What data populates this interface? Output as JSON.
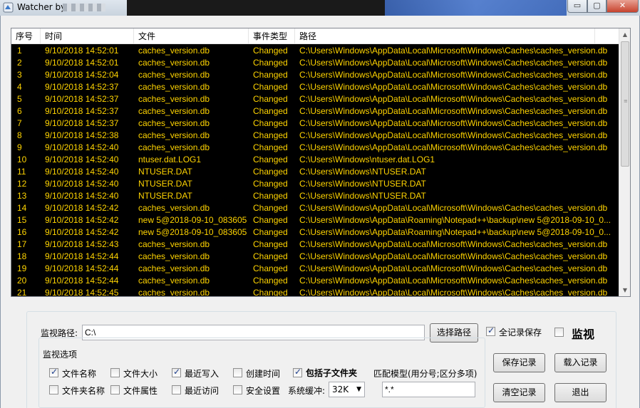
{
  "window": {
    "title": "Watcher by",
    "minimize_glyph": "▭",
    "maximize_glyph": "▢",
    "close_glyph": "✕"
  },
  "list": {
    "columns": [
      "序号",
      "时间",
      "文件",
      "事件类型",
      "路径"
    ],
    "rows": [
      [
        "1",
        "9/10/2018 14:52:01",
        "caches_version.db",
        "Changed",
        "C:\\Users\\Windows\\AppData\\Local\\Microsoft\\Windows\\Caches\\caches_version.db"
      ],
      [
        "2",
        "9/10/2018 14:52:01",
        "caches_version.db",
        "Changed",
        "C:\\Users\\Windows\\AppData\\Local\\Microsoft\\Windows\\Caches\\caches_version.db"
      ],
      [
        "3",
        "9/10/2018 14:52:04",
        "caches_version.db",
        "Changed",
        "C:\\Users\\Windows\\AppData\\Local\\Microsoft\\Windows\\Caches\\caches_version.db"
      ],
      [
        "4",
        "9/10/2018 14:52:37",
        "caches_version.db",
        "Changed",
        "C:\\Users\\Windows\\AppData\\Local\\Microsoft\\Windows\\Caches\\caches_version.db"
      ],
      [
        "5",
        "9/10/2018 14:52:37",
        "caches_version.db",
        "Changed",
        "C:\\Users\\Windows\\AppData\\Local\\Microsoft\\Windows\\Caches\\caches_version.db"
      ],
      [
        "6",
        "9/10/2018 14:52:37",
        "caches_version.db",
        "Changed",
        "C:\\Users\\Windows\\AppData\\Local\\Microsoft\\Windows\\Caches\\caches_version.db"
      ],
      [
        "7",
        "9/10/2018 14:52:37",
        "caches_version.db",
        "Changed",
        "C:\\Users\\Windows\\AppData\\Local\\Microsoft\\Windows\\Caches\\caches_version.db"
      ],
      [
        "8",
        "9/10/2018 14:52:38",
        "caches_version.db",
        "Changed",
        "C:\\Users\\Windows\\AppData\\Local\\Microsoft\\Windows\\Caches\\caches_version.db"
      ],
      [
        "9",
        "9/10/2018 14:52:40",
        "caches_version.db",
        "Changed",
        "C:\\Users\\Windows\\AppData\\Local\\Microsoft\\Windows\\Caches\\caches_version.db"
      ],
      [
        "10",
        "9/10/2018 14:52:40",
        "ntuser.dat.LOG1",
        "Changed",
        "C:\\Users\\Windows\\ntuser.dat.LOG1"
      ],
      [
        "11",
        "9/10/2018 14:52:40",
        "NTUSER.DAT",
        "Changed",
        "C:\\Users\\Windows\\NTUSER.DAT"
      ],
      [
        "12",
        "9/10/2018 14:52:40",
        "NTUSER.DAT",
        "Changed",
        "C:\\Users\\Windows\\NTUSER.DAT"
      ],
      [
        "13",
        "9/10/2018 14:52:40",
        "NTUSER.DAT",
        "Changed",
        "C:\\Users\\Windows\\NTUSER.DAT"
      ],
      [
        "14",
        "9/10/2018 14:52:42",
        "caches_version.db",
        "Changed",
        "C:\\Users\\Windows\\AppData\\Local\\Microsoft\\Windows\\Caches\\caches_version.db"
      ],
      [
        "15",
        "9/10/2018 14:52:42",
        "new 5@2018-09-10_083605",
        "Changed",
        "C:\\Users\\Windows\\AppData\\Roaming\\Notepad++\\backup\\new 5@2018-09-10_0..."
      ],
      [
        "16",
        "9/10/2018 14:52:42",
        "new 5@2018-09-10_083605",
        "Changed",
        "C:\\Users\\Windows\\AppData\\Roaming\\Notepad++\\backup\\new 5@2018-09-10_0..."
      ],
      [
        "17",
        "9/10/2018 14:52:43",
        "caches_version.db",
        "Changed",
        "C:\\Users\\Windows\\AppData\\Local\\Microsoft\\Windows\\Caches\\caches_version.db"
      ],
      [
        "18",
        "9/10/2018 14:52:44",
        "caches_version.db",
        "Changed",
        "C:\\Users\\Windows\\AppData\\Local\\Microsoft\\Windows\\Caches\\caches_version.db"
      ],
      [
        "19",
        "9/10/2018 14:52:44",
        "caches_version.db",
        "Changed",
        "C:\\Users\\Windows\\AppData\\Local\\Microsoft\\Windows\\Caches\\caches_version.db"
      ],
      [
        "20",
        "9/10/2018 14:52:44",
        "caches_version.db",
        "Changed",
        "C:\\Users\\Windows\\AppData\\Local\\Microsoft\\Windows\\Caches\\caches_version.db"
      ],
      [
        "21",
        "9/10/2018 14:52:45",
        "caches_version.db",
        "Changed",
        "C:\\Users\\Windows\\AppData\\Local\\Microsoft\\Windows\\Caches\\caches_version.db"
      ]
    ],
    "scroll_up_glyph": "▲",
    "scroll_down_glyph": "▼",
    "scroll_grip_glyph": "≡"
  },
  "monitor": {
    "path_label": "监视路径:",
    "path_value": "C:\\",
    "choose_path_button": "选择路径",
    "save_all_label": "全记录保存",
    "save_all_checked": true,
    "monitor_label": "监视",
    "monitor_checked": false
  },
  "options": {
    "group_label": "监视选项",
    "items": [
      {
        "label": "文件名称",
        "checked": true
      },
      {
        "label": "文件大小",
        "checked": false
      },
      {
        "label": "最近写入",
        "checked": true
      },
      {
        "label": "创建时间",
        "checked": false
      },
      {
        "label": "包括子文件夹",
        "checked": true
      },
      {
        "label": "文件夹名称",
        "checked": false
      },
      {
        "label": "文件属性",
        "checked": false
      },
      {
        "label": "最近访问",
        "checked": false
      },
      {
        "label": "安全设置",
        "checked": false
      }
    ],
    "buffer_label": "系统缓冲:",
    "buffer_value": "32K",
    "pattern_label": "匹配模型(用分号;区分多项)",
    "pattern_value": "*.*"
  },
  "actions": {
    "save_records": "保存记录",
    "load_records": "载入记录",
    "clear_records": "清空记录",
    "exit": "退出"
  }
}
